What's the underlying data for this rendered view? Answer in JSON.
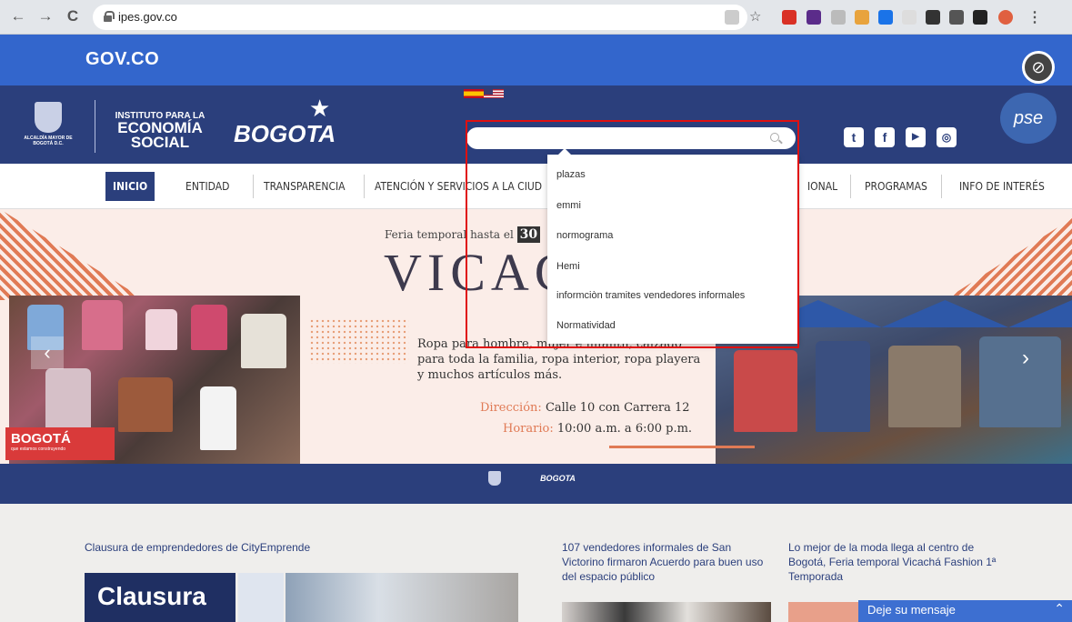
{
  "browser": {
    "url": "ipes.gov.co",
    "back_label": "←",
    "forward_label": "→",
    "reload_label": "C"
  },
  "gov_bar": {
    "logo_text": "GOV.CO"
  },
  "header": {
    "alcaldia_text": "ALCALDÍA MAYOR DE BOGOTÁ D.C.",
    "ipes_line1": "INSTITUTO PARA LA",
    "ipes_line2": "ECONOMÍA",
    "ipes_line3": "SOCIAL",
    "bogota_text": "BOGOTA",
    "pse_text": "pse"
  },
  "search": {
    "value": "",
    "suggestions": [
      "plazas",
      "emmi",
      "normograma",
      "Hemi",
      "informciòn tramites vendedores informales",
      "Normatividad"
    ]
  },
  "menu": {
    "items": [
      "INICIO",
      "ENTIDAD",
      "TRANSPARENCIA",
      "ATENCIÓN Y SERVICIOS A LA CIUD",
      "IONAL",
      "PROGRAMAS",
      "INFO DE INTERÉS"
    ]
  },
  "banner": {
    "feria_prefix": "Feria temporal hasta el",
    "feria_date": "30",
    "title": "VICAC",
    "description": "Ropa para hombre, mujer e infantil, calzado para toda la familia, ropa interior, ropa playera y muchos artículos más.",
    "direccion_label": "Dirección:",
    "direccion_value": "Calle 10 con Carrera 12",
    "horario_label": "Horario:",
    "horario_value": "10:00 a.m. a 6:00 p.m.",
    "badge_text": "BOGOTÁ",
    "badge_sub": "que estamos construyendo"
  },
  "news": [
    {
      "title": "Clausura de emprendedores de CityEmprende"
    },
    {
      "title": "107 vendedores informales de San Victorino firmaron Acuerdo para buen uso del espacio público"
    },
    {
      "title": "Lo mejor de la moda llega al centro de Bogotá, Feria temporal Vicachá Fashion 1ª Temporada"
    }
  ],
  "news_image_text": "Clausura",
  "chat": {
    "label": "Deje su mensaje"
  },
  "colors": {
    "gov_blue": "#3366cc",
    "ipes_navy": "#2b3f7c",
    "accent_orange": "#e07a55",
    "highlight_red": "#e01010"
  }
}
